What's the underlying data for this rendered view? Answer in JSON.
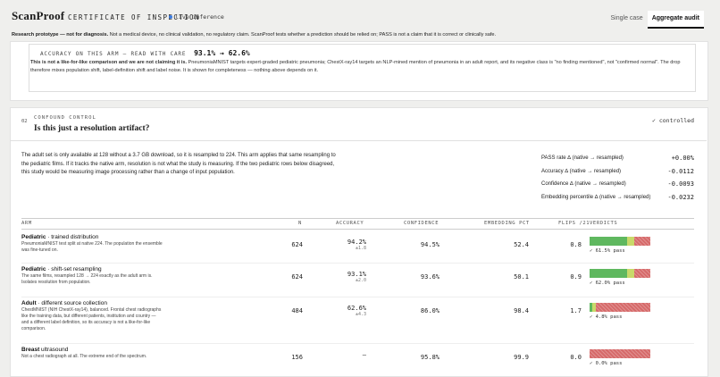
{
  "header": {
    "logo": "ScanProof",
    "subtitle": "CERTIFICATE OF INSPECTION",
    "live": "live inference",
    "tabs": [
      {
        "label": "Single case"
      },
      {
        "label": "Aggregate audit"
      }
    ]
  },
  "banner": {
    "lead": "Research prototype — not for diagnosis.",
    "text": " Not a medical device, no clinical validation, no regulatory claim. ScanProof tests whether a prediction should be relied on; PASS is not a claim that it is correct or clinically safe."
  },
  "accuracy_card": {
    "label": "ACCURACY ON THIS ARM — READ WITH CARE",
    "value": "93.1% → 62.6%",
    "notes_lead": "This is not a like-for-like comparison and we are not claiming it is.",
    "notes_text": " PneumoniaMNIST targets expert-graded pediatric pneumonia; ChestX-ray14 targets an NLP-mined mention of pneumonia in an adult report, and its negative class is \"no finding mentioned\", not \"confirmed normal\". The drop therefore mixes population shift, label-definition shift and label noise. It is shown for completeness — nothing above depends on it."
  },
  "question": {
    "num": "02",
    "tag": "CONFOUND CONTROL",
    "title": "Is this just a resolution artifact?",
    "status": "✓ controlled",
    "para": "The adult set is only available at 128 without a 3.7 GB download, so it is resampled to 224. This arm applies that same resampling to the pediatric films. If it tracks the native arm, resolution is not what the study is measuring. If the two pediatric rows below disagreed, this study would be measuring image processing rather than a change of input population."
  },
  "metrics": [
    {
      "label": "PASS rate ∆ (native → resampled)",
      "value": "+0.00%"
    },
    {
      "label": "Accuracy ∆ (native → resampled)",
      "value": "-0.0112"
    },
    {
      "label": "Confidence ∆ (native → resampled)",
      "value": "-0.0093"
    },
    {
      "label": "Embedding percentile ∆ (native → resampled)",
      "value": "-0.0232"
    }
  ],
  "table": {
    "headers": {
      "arm": "ARM",
      "n": "N",
      "accuracy": "ACCURACY",
      "confidence": "CONFIDENCE",
      "embedding": "EMBEDDING PCT",
      "flips": "FLIPS /21",
      "verdicts": "VERDICTS"
    },
    "rows": [
      {
        "title_b": "Pediatric",
        "title": " · trained distribution",
        "desc": "PneumoniaMNIST test split at native 224. The population the ensemble was fine-tuned on.",
        "n": "624",
        "acc": "94.2%",
        "acc_sub": "±1.8",
        "conf": "94.5%",
        "emb": "52.4",
        "flips": "0.8",
        "pass": 0.615,
        "warn": 0.12,
        "fail": 0.265,
        "verdict": "✓ 61.5% pass"
      },
      {
        "title_b": "Pediatric",
        "title": " · shift-set resampling",
        "desc": "The same films, resampled 128 → 224 exactly as the adult arm is. Isolates resolution from population.",
        "n": "624",
        "acc": "93.1%",
        "acc_sub": "±2.0",
        "conf": "93.6%",
        "emb": "50.1",
        "flips": "0.9",
        "pass": 0.62,
        "warn": 0.11,
        "fail": 0.27,
        "verdict": "✓ 62.0% pass"
      },
      {
        "title_b": "Adult",
        "title": " · different source collection",
        "desc": "ChestMNIST (NIH ChestX-ray14), balanced. Frontal chest radiographs like the training data, but different patients, institution and country — and a different label definition, so its accuracy is not a like-for-like comparison.",
        "n": "484",
        "acc": "62.6%",
        "acc_sub": "±4.3",
        "conf": "86.0%",
        "emb": "98.4",
        "flips": "1.7",
        "pass": 0.048,
        "warn": 0.05,
        "fail": 0.902,
        "verdict": "✓ 4.8% pass"
      },
      {
        "title_b": "Breast",
        "title": " ultrasound",
        "desc": "Not a chest radiograph at all. The extreme end of the spectrum.",
        "n": "156",
        "acc": "—",
        "acc_sub": "",
        "conf": "95.8%",
        "emb": "99.9",
        "flips": "0.0",
        "pass": 0.0,
        "warn": 0.0,
        "fail": 1.0,
        "verdict": "✓ 0.0% pass"
      }
    ]
  },
  "colors": {
    "pass": "#5fb85f",
    "warn": "#c9d96a",
    "fail": "#d66a6a",
    "accent": "#3b7be0"
  }
}
